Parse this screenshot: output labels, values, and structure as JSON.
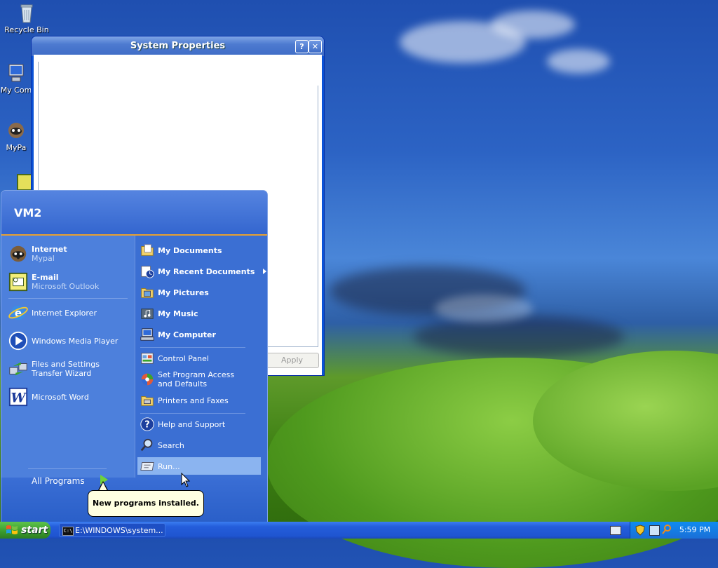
{
  "desktop": {
    "icons": [
      {
        "label": "Recycle Bin",
        "icon": "recycle-bin-icon"
      },
      {
        "label": "My Com",
        "icon": "my-computer-icon"
      },
      {
        "label": "MyPa",
        "icon": "mypal-icon"
      }
    ]
  },
  "window": {
    "title": "System Properties",
    "help_btn": "?",
    "close_btn": "✕",
    "apply_label": "Apply"
  },
  "start_menu": {
    "user_name": "VM2",
    "pinned": [
      {
        "primary": "Internet",
        "secondary": "Mypal",
        "icon": "mypal-raccoon-icon"
      },
      {
        "primary": "E-mail",
        "secondary": "Microsoft Outlook",
        "icon": "outlook-icon"
      }
    ],
    "recent": [
      {
        "label": "Internet Explorer",
        "icon": "internet-explorer-icon"
      },
      {
        "label": "Windows Media Player",
        "icon": "media-player-icon"
      },
      {
        "label": "Files and Settings Transfer Wizard",
        "icon": "transfer-wizard-icon"
      },
      {
        "label": "Microsoft Word",
        "icon": "word-icon"
      }
    ],
    "all_programs": "All Programs",
    "right_items": [
      {
        "label": "My Documents",
        "icon": "folder-documents-icon"
      },
      {
        "label": "My Recent Documents",
        "icon": "recent-documents-icon"
      },
      {
        "label": "My Pictures",
        "icon": "pictures-icon"
      },
      {
        "label": "My Music",
        "icon": "music-icon"
      },
      {
        "label": "My Computer",
        "icon": "computer-icon"
      },
      {
        "label": "Control Panel",
        "icon": "control-panel-icon"
      },
      {
        "label": "Set Program Access and Defaults",
        "icon": "program-access-icon"
      },
      {
        "label": "Printers and Faxes",
        "icon": "printers-icon"
      },
      {
        "label": "Help and Support",
        "icon": "help-icon"
      },
      {
        "label": "Search",
        "icon": "search-icon"
      },
      {
        "label": "Run...",
        "icon": "run-icon"
      }
    ],
    "balloon": "New programs installed."
  },
  "taskbar": {
    "start_label": "start",
    "task_label": "E:\\WINDOWS\\system...",
    "clock": "5:59 PM"
  }
}
